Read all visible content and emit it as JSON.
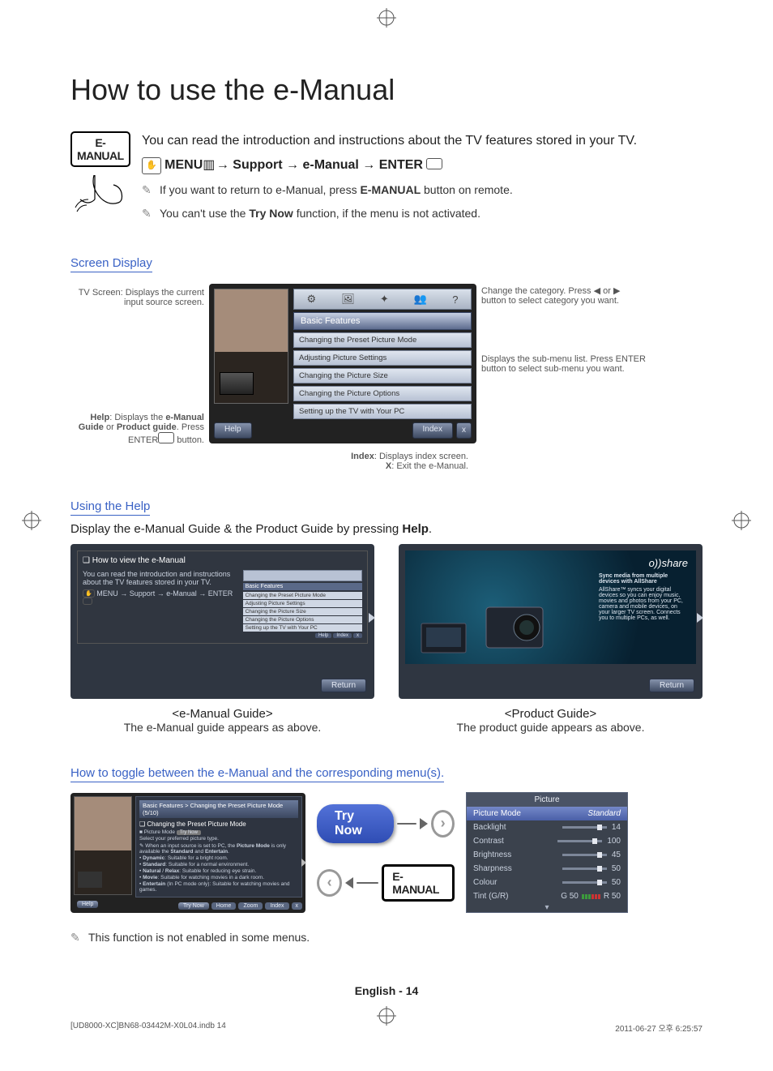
{
  "title": "How to use the e-Manual",
  "intro": {
    "icon_label": "E-MANUAL",
    "text": "You can read the introduction and instructions about the TV features stored in your TV.",
    "menu_path": {
      "menu": "MENU",
      "p1": "Support",
      "p2": "e-Manual",
      "enter": "ENTER"
    },
    "note1_a": "If you want to return to e-Manual, press ",
    "note1_b": "E-MANUAL",
    "note1_c": " button on remote.",
    "note2_a": "You can't use the ",
    "note2_b": "Try Now",
    "note2_c": " function, if the menu is not activated."
  },
  "screen_display": {
    "heading": "Screen Display",
    "callouts": {
      "tvscreen": "TV Screen: Displays the current input source screen.",
      "help_a": "Help",
      "help_b": ": Displays the ",
      "help_c": "e-Manual Guide",
      "help_d": " or ",
      "help_e": "Product guide",
      "help_f": ". Press ENTER",
      "help_g": " button.",
      "category": "Change the category. Press ◀ or ▶ button to select category you want.",
      "submenu": "Displays the sub-menu list. Press ENTER button to select sub-menu you want.",
      "index_a": "Index",
      "index_b": ": Displays index screen.",
      "x_a": "X",
      "x_b": ": Exit the e-Manual."
    },
    "category_label": "Basic Features",
    "rows": {
      "r1": "Changing the Preset Picture Mode",
      "r2": "Adjusting Picture Settings",
      "r3": "Changing the Picture Size",
      "r4": "Changing the Picture Options",
      "r5": "Setting up the TV with Your PC"
    },
    "bottom": {
      "help": "Help",
      "index": "Index",
      "x": "x"
    }
  },
  "using_help": {
    "heading": "Using the Help",
    "line_a": "Display the e-Manual Guide & the Product Guide by pressing ",
    "line_b": "Help",
    "line_c": ".",
    "emg": {
      "title": "❑ How to view the e-Manual",
      "body": "You can read the introduction and instructions about the TV features stored in your TV.",
      "path": "MENU → Support → e-Manual → ENTER",
      "cat": "Basic Features",
      "r1": "Changing the Preset Picture Mode",
      "r2": "Adjusting Picture Settings",
      "r3": "Changing the Picture Size",
      "r4": "Changing the Picture Options",
      "r5": "Setting up the TV with Your PC",
      "help": "Help",
      "index": "Index",
      "x": "x",
      "return": "Return",
      "caption_title": "<e-Manual Guide>",
      "caption_sub": "The e-Manual guide appears as above."
    },
    "pg": {
      "brand": "o))share",
      "head": "Sync media from multiple devices with AllShare",
      "body": "AllShare™ syncs your digital devices so you can enjoy music, movies and photos from your PC, camera and mobile devices, on your larger TV screen. Connects you to multiple PCs, as well.",
      "return": "Return",
      "caption_title": "<Product Guide>",
      "caption_sub": "The product guide appears as above."
    }
  },
  "toggle": {
    "heading": "How to toggle between the e-Manual and the corresponding menu(s).",
    "left": {
      "crumb": "Basic Features > Changing the Preset Picture Mode (5/10)",
      "h": "❑ Changing the Preset Picture Mode",
      "pm_label": "■ Picture Mode",
      "pm_btn": "Try Now",
      "sel": "Select your preferred picture type.",
      "note_a": "When an input source is set to PC, the ",
      "note_b": "Picture Mode",
      "note_c": " is only available the ",
      "note_d": "Standard",
      "note_e": " and ",
      "note_f": "Entertain",
      "note_g": ".",
      "b1a": "Dynamic",
      "b1b": ": Suitable for a bright room.",
      "b2a": "Standard",
      "b2b": ": Suitable for a normal environment.",
      "b3a": "Natural",
      "b3b": " / ",
      "b3c": "Relax",
      "b3d": ": Suitable for reducing eye strain.",
      "b4a": "Movie",
      "b4b": ": Suitable for watching movies in a dark room.",
      "b5a": "Entertain",
      "b5b": " (In PC mode only): Suitable for watching movies and games.",
      "help": "Help",
      "try": "Try Now",
      "home": "Home",
      "zoom": "Zoom",
      "index": "Index",
      "x": "x"
    },
    "mid": {
      "try": "Try Now",
      "em": "E-MANUAL"
    },
    "right": {
      "title": "Picture",
      "sel_label": "Picture Mode",
      "sel_value": "Standard",
      "rows": [
        {
          "label": "Backlight",
          "value": "14"
        },
        {
          "label": "Contrast",
          "value": "100"
        },
        {
          "label": "Brightness",
          "value": "45"
        },
        {
          "label": "Sharpness",
          "value": "50"
        },
        {
          "label": "Colour",
          "value": "50"
        }
      ],
      "tint_label": "Tint (G/R)",
      "tint_g": "G 50",
      "tint_r": "R 50"
    },
    "note": "This function is not enabled in some menus."
  },
  "footer": {
    "page": "English - 14",
    "left": "[UD8000-XC]BN68-03442M-X0L04.indb   14",
    "right": "2011-06-27   오후 6:25:57"
  }
}
